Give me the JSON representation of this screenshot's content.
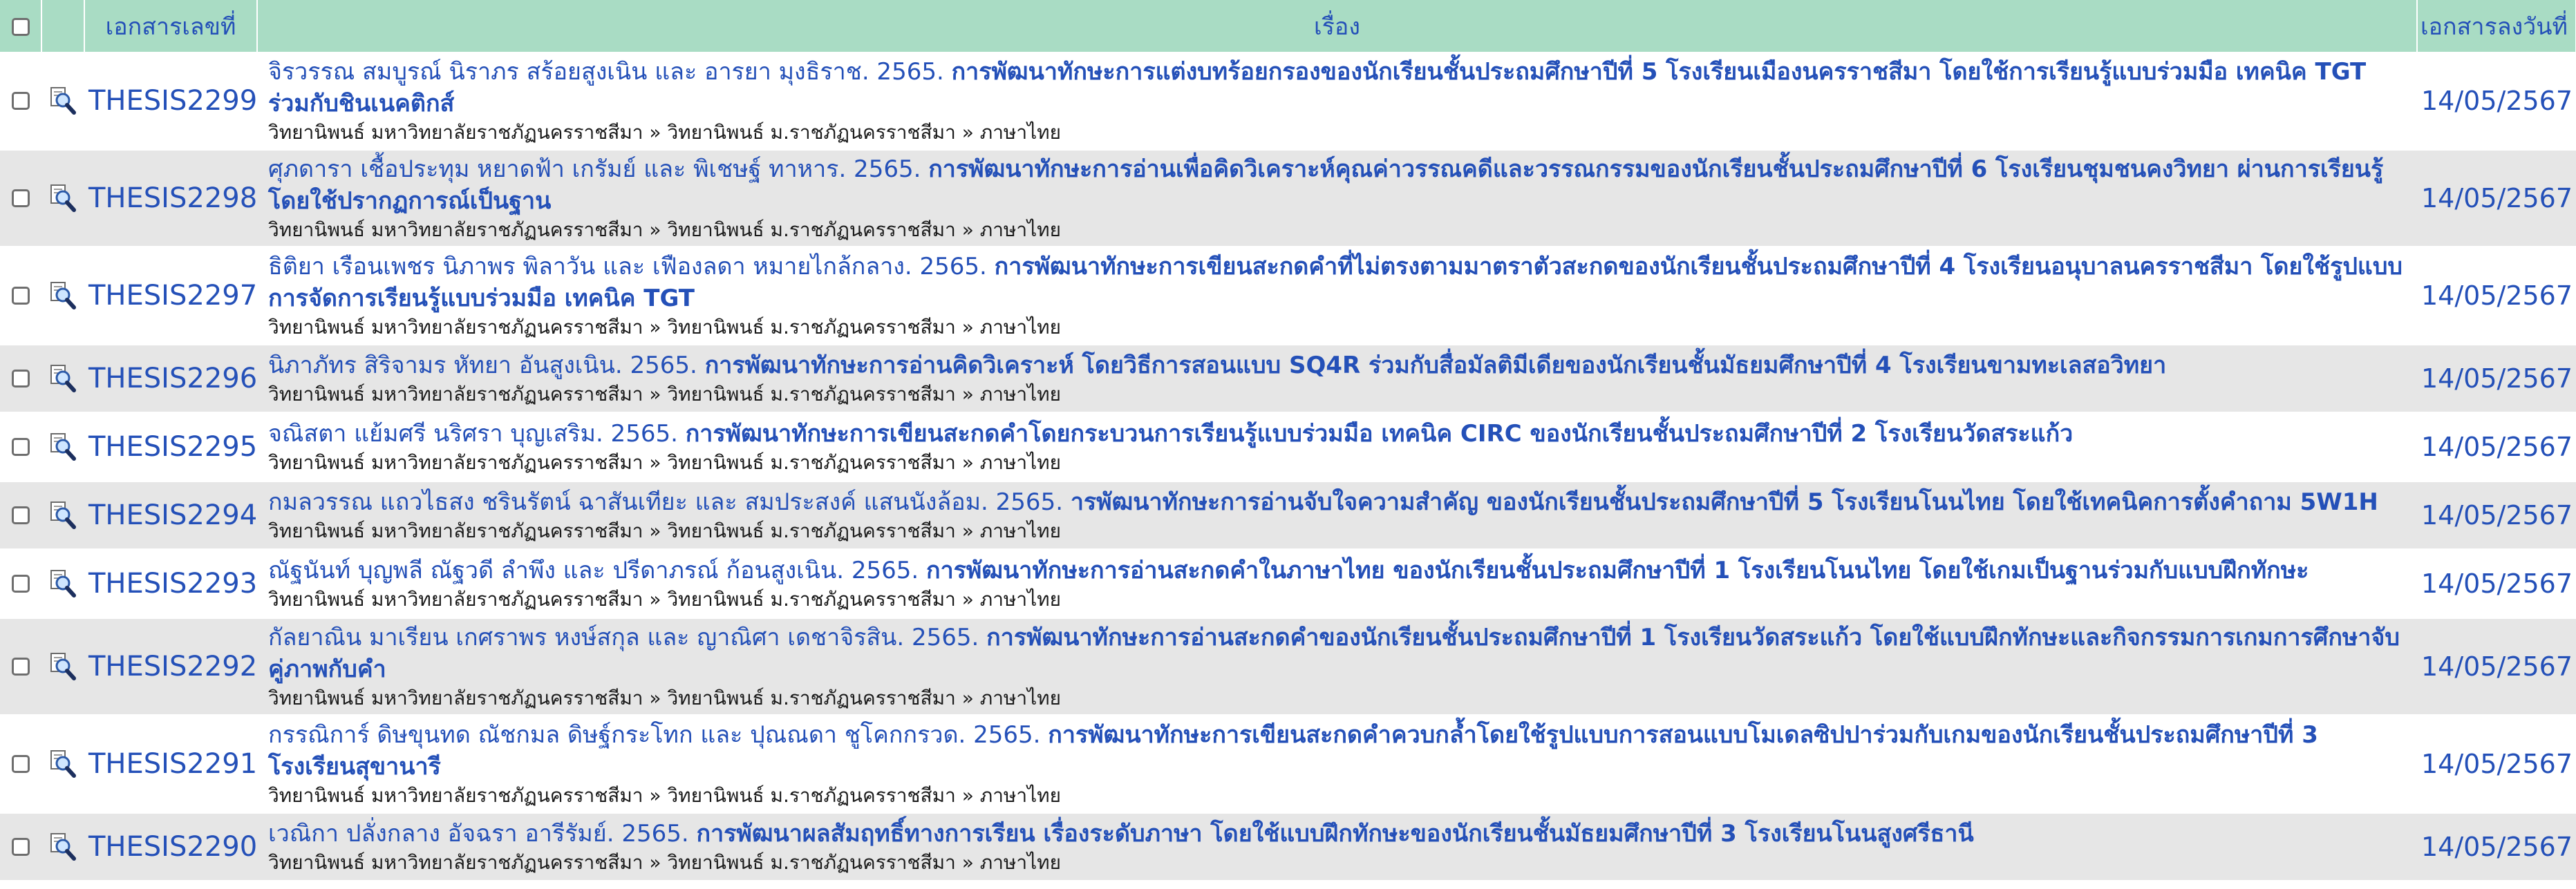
{
  "header": {
    "col_id": "เอกสารเลขที่",
    "col_title": "เรื่อง",
    "col_date": "เอกสารลงวันที่"
  },
  "meta_breadcrumb": "วิทยานิพนธ์ มหาวิทยาลัยราชภัฏนครราชสีมา » วิทยานิพนธ์ ม.ราชภัฏนครราชสีมา » ภาษาไทย",
  "rows": [
    {
      "id": "THESIS2299",
      "authors": "จิรวรรณ สมบูรณ์ นิราภร สร้อยสูงเนิน และ อารยา มุงธิราช. 2565.",
      "title": "การพัฒนาทักษะการแต่งบทร้อยกรองของนักเรียนชั้นประถมศึกษาปีที่ 5 โรงเรียนเมืองนครราชสีมา โดยใช้การเรียนรู้แบบร่วมมือ เทคนิค TGT ร่วมกับชินเนคติกส์",
      "breadcrumb": "วิทยานิพนธ์ มหาวิทยาลัยราชภัฏนครราชสีมา » วิทยานิพนธ์ ม.ราชภัฏนครราชสีมา » ภาษาไทย",
      "date": "14/05/2567"
    },
    {
      "id": "THESIS2298",
      "authors": "ศุภดารา เชื้อประทุม หยาดฟ้า เกรัมย์ และ พิเชษฐ์ ทาหาร. 2565.",
      "title": "การพัฒนาทักษะการอ่านเพื่อคิดวิเคราะห์คุณค่าวรรณคดีและวรรณกรรมของนักเรียนชั้นประถมศึกษาปีที่ 6 โรงเรียนชุมชนคงวิทยา ผ่านการเรียนรู้โดยใช้ปรากฏการณ์เป็นฐาน",
      "breadcrumb": "วิทยานิพนธ์ มหาวิทยาลัยราชภัฏนครราชสีมา » วิทยานิพนธ์ ม.ราชภัฏนครราชสีมา » ภาษาไทย",
      "date": "14/05/2567"
    },
    {
      "id": "THESIS2297",
      "authors": "ธิติยา เรือนเพชร นิภาพร พิลาวัน และ เฟืองลดา หมายไกล้กลาง. 2565.",
      "title": "การพัฒนาทักษะการเขียนสะกดคำที่ไม่ตรงตามมาตราตัวสะกดของนักเรียนชั้นประถมศึกษาปีที่ 4 โรงเรียนอนุบาลนครราชสีมา โดยใช้รูปแบบการจัดการเรียนรู้แบบร่วมมือ เทคนิค TGT",
      "breadcrumb": "วิทยานิพนธ์ มหาวิทยาลัยราชภัฏนครราชสีมา » วิทยานิพนธ์ ม.ราชภัฏนครราชสีมา » ภาษาไทย",
      "date": "14/05/2567"
    },
    {
      "id": "THESIS2296",
      "authors": "นิภาภัทร สิริจามร หัทยา อันสูงเนิน. 2565.",
      "title": "การพัฒนาทักษะการอ่านคิดวิเคราะห์ โดยวิธีการสอนแบบ SQ4R ร่วมกับสื่อมัลติมีเดียของนักเรียนชั้นมัธยมศึกษาปีที่ 4 โรงเรียนขามทะเลสอวิทยา",
      "breadcrumb": "วิทยานิพนธ์ มหาวิทยาลัยราชภัฏนครราชสีมา » วิทยานิพนธ์ ม.ราชภัฏนครราชสีมา » ภาษาไทย",
      "date": "14/05/2567"
    },
    {
      "id": "THESIS2295",
      "authors": "จณิสตา แย้มศรี นริศรา บุญเสริม. 2565.",
      "title": "การพัฒนาทักษะการเขียนสะกดคำโดยกระบวนการเรียนรู้แบบร่วมมือ เทคนิค CIRC ของนักเรียนชั้นประถมศึกษาปีที่ 2 โรงเรียนวัดสระแก้ว",
      "breadcrumb": "วิทยานิพนธ์ มหาวิทยาลัยราชภัฏนครราชสีมา » วิทยานิพนธ์ ม.ราชภัฏนครราชสีมา » ภาษาไทย",
      "date": "14/05/2567"
    },
    {
      "id": "THESIS2294",
      "authors": "กมลวรรณ แถวไธสง ชรินรัตน์ ฉาสันเทียะ และ สมประสงค์ แสนนังล้อม. 2565.",
      "title": "ารพัฒนาทักษะการอ่านจับใจความสำคัญ ของนักเรียนชั้นประถมศึกษาปีที่ 5 โรงเรียนโนนไทย โดยใช้เทคนิคการตั้งคำถาม 5W1H",
      "breadcrumb": "วิทยานิพนธ์ มหาวิทยาลัยราชภัฏนครราชสีมา » วิทยานิพนธ์ ม.ราชภัฏนครราชสีมา » ภาษาไทย",
      "date": "14/05/2567"
    },
    {
      "id": "THESIS2293",
      "authors": "ณัฐนันท์ บุญพลี ณัฐวดี ลำพึง และ ปรีดาภรณ์ ก้อนสูงเนิน. 2565.",
      "title": "การพัฒนาทักษะการอ่านสะกดคำในภาษาไทย ของนักเรียนชั้นประถมศึกษาปีที่ 1 โรงเรียนโนนไทย โดยใช้เกมเป็นฐานร่วมกับแบบฝึกทักษะ",
      "breadcrumb": "วิทยานิพนธ์ มหาวิทยาลัยราชภัฏนครราชสีมา » วิทยานิพนธ์ ม.ราชภัฏนครราชสีมา » ภาษาไทย",
      "date": "14/05/2567"
    },
    {
      "id": "THESIS2292",
      "authors": "กัลยาณิน มาเรียน เกศราพร หงษ์สกุล และ ญาณิศา เดชาจิรสิน. 2565.",
      "title": "การพัฒนาทักษะการอ่านสะกดคำของนักเรียนชั้นประถมศึกษาปีที่ 1 โรงเรียนวัดสระแก้ว โดยใช้แบบฝึกทักษะและกิจกรรมการเกมการศึกษาจับคู่ภาพกับคำ",
      "breadcrumb": "วิทยานิพนธ์ มหาวิทยาลัยราชภัฏนครราชสีมา » วิทยานิพนธ์ ม.ราชภัฏนครราชสีมา » ภาษาไทย",
      "date": "14/05/2567"
    },
    {
      "id": "THESIS2291",
      "authors": "กรรณิการ์ ดิษขุนทด ณัชกมล ดิษฐ์กระโทก และ ปุณณดา ชูโคกกรวด. 2565.",
      "title": "การพัฒนาทักษะการเขียนสะกดคำควบกล้ำโดยใช้รูปแบบการสอนแบบโมเดลซิปปาร่วมกับเกมของนักเรียนชั้นประถมศึกษาปีที่ 3 โรงเรียนสุขานารี",
      "breadcrumb": "วิทยานิพนธ์ มหาวิทยาลัยราชภัฏนครราชสีมา » วิทยานิพนธ์ ม.ราชภัฏนครราชสีมา » ภาษาไทย",
      "date": "14/05/2567"
    },
    {
      "id": "THESIS2290",
      "authors": "เวณิกา ปลั่งกลาง อัจฉรา อารีรัมย์. 2565.",
      "title": "การพัฒนาผลสัมฤทธิ์ทางการเรียน เรื่องระดับภาษา โดยใช้แบบฝึกทักษะของนักเรียนชั้นมัธยมศึกษาปีที่ 3 โรงเรียนโนนสูงศรีธานี",
      "breadcrumb": "วิทยานิพนธ์ มหาวิทยาลัยราชภัฏนครราชสีมา » วิทยานิพนธ์ ม.ราชภัฏนครราชสีมา » ภาษาไทย",
      "date": "14/05/2567"
    }
  ],
  "icons": {
    "row_action": "magnifier-document-icon"
  },
  "colors": {
    "header_bg": "#a9dcc4",
    "link": "#2450b8",
    "row_alt_bg": "#e6e6e6"
  }
}
